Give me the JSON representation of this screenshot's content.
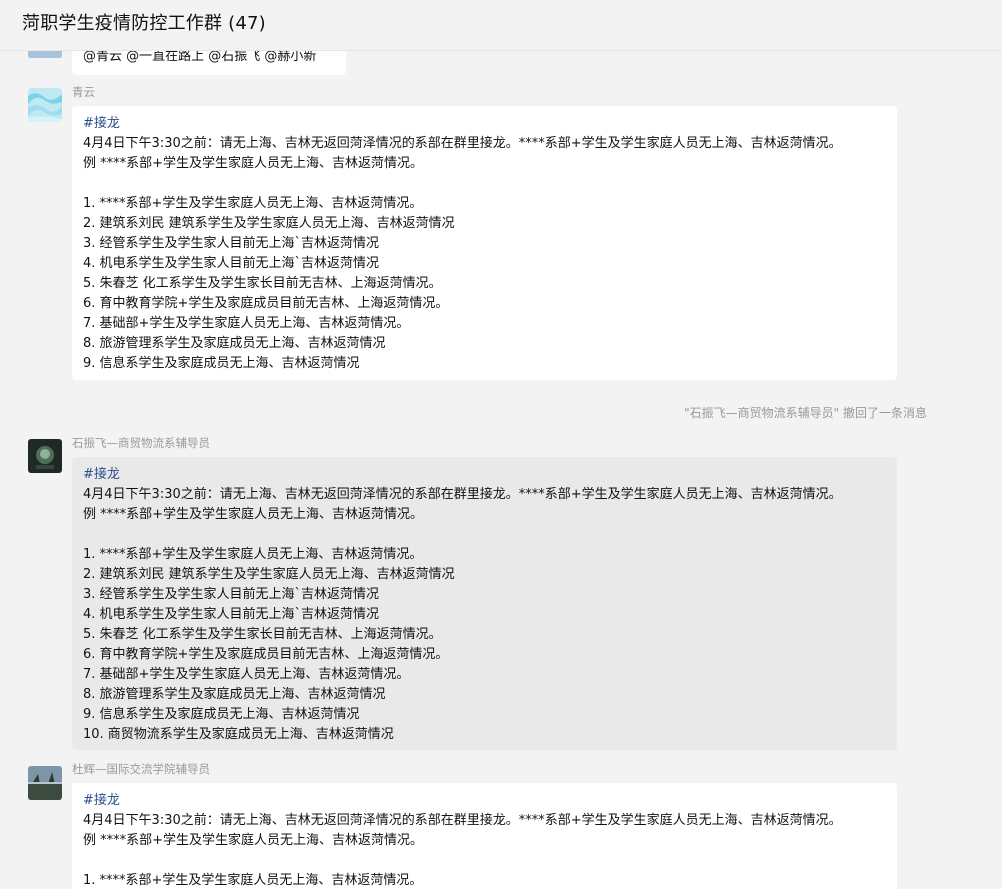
{
  "window": {
    "title": "菏职学生疫情防控工作群 (47)"
  },
  "messages": [
    {
      "id": "m0",
      "sender": "",
      "lines": [
        "@青云 @一直在路上 @石振飞 @赫小新"
      ]
    },
    {
      "id": "m1",
      "sender": "青云",
      "tag": "#接龙",
      "intro": [
        "4月4日下午3:30之前：请无上海、吉林无返回菏泽情况的系部在群里接龙。****系部+学生及学生家庭人员无上海、吉林返菏情况。",
        "例 ****系部+学生及学生家庭人员无上海、吉林返菏情况。"
      ],
      "items": [
        "1. ****系部+学生及学生家庭人员无上海、吉林返菏情况。",
        "2. 建筑系刘民 建筑系学生及学生家庭人员无上海、吉林返菏情况",
        "3. 经管系学生及学生家人目前无上海`吉林返菏情况",
        "4. 机电系学生及学生家人目前无上海`吉林返菏情况",
        "5. 朱春芝 化工系学生及学生家长目前无吉林、上海返菏情况。",
        "6. 育中教育学院+学生及家庭成员目前无吉林、上海返菏情况。",
        "7. 基础部+学生及学生家庭人员无上海、吉林返菏情况。",
        "8. 旅游管理系学生及家庭成员无上海、吉林返菏情况",
        "9. 信息系学生及家庭成员无上海、吉林返菏情况"
      ]
    },
    {
      "id": "recall",
      "text": "\"石振飞—商贸物流系辅导员\" 撤回了一条消息"
    },
    {
      "id": "m2",
      "sender": "石振飞—商贸物流系辅导员",
      "tag": "#接龙",
      "intro": [
        "4月4日下午3:30之前：请无上海、吉林无返回菏泽情况的系部在群里接龙。****系部+学生及学生家庭人员无上海、吉林返菏情况。",
        "例 ****系部+学生及学生家庭人员无上海、吉林返菏情况。"
      ],
      "items": [
        "1. ****系部+学生及学生家庭人员无上海、吉林返菏情况。",
        "2. 建筑系刘民 建筑系学生及学生家庭人员无上海、吉林返菏情况",
        "3. 经管系学生及学生家人目前无上海`吉林返菏情况",
        "4. 机电系学生及学生家人目前无上海`吉林返菏情况",
        "5. 朱春芝 化工系学生及学生家长目前无吉林、上海返菏情况。",
        "6. 育中教育学院+学生及家庭成员目前无吉林、上海返菏情况。",
        "7. 基础部+学生及学生家庭人员无上海、吉林返菏情况。",
        "8. 旅游管理系学生及家庭成员无上海、吉林返菏情况",
        "9. 信息系学生及家庭成员无上海、吉林返菏情况",
        "10. 商贸物流系学生及家庭成员无上海、吉林返菏情况"
      ]
    },
    {
      "id": "m3",
      "sender": "杜辉—国际交流学院辅导员",
      "tag": "#接龙",
      "intro": [
        "4月4日下午3:30之前：请无上海、吉林无返回菏泽情况的系部在群里接龙。****系部+学生及学生家庭人员无上海、吉林返菏情况。",
        "例 ****系部+学生及学生家庭人员无上海、吉林返菏情况。"
      ],
      "items": [
        "1. ****系部+学生及学生家庭人员无上海、吉林返菏情况。"
      ]
    }
  ]
}
